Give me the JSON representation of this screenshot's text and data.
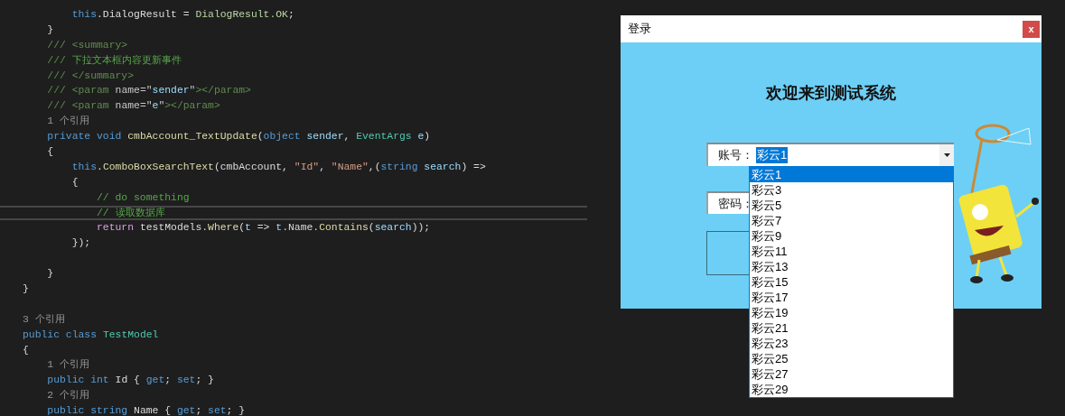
{
  "code_editor": {
    "lines": [
      {
        "current": false,
        "tokens": [
          {
            "text": "        this",
            "kind": "keyword"
          },
          {
            "text": ".DialogResult = ",
            "kind": "plain"
          },
          {
            "text": "DialogResult.OK",
            "kind": "enum"
          },
          {
            "text": ";",
            "kind": "plain"
          }
        ]
      },
      {
        "current": false,
        "tokens": [
          {
            "text": "    }",
            "kind": "plain"
          }
        ]
      },
      {
        "current": false,
        "tokens": [
          {
            "text": "    /// <summary>",
            "kind": "doc"
          }
        ]
      },
      {
        "current": false,
        "tokens": [
          {
            "text": "    /// ",
            "kind": "doc"
          },
          {
            "text": "下拉文本框内容更新事件",
            "kind": "comment"
          }
        ]
      },
      {
        "current": false,
        "tokens": [
          {
            "text": "    /// </summary>",
            "kind": "doc"
          }
        ]
      },
      {
        "current": false,
        "tokens": [
          {
            "text": "    /// <param ",
            "kind": "doc"
          },
          {
            "text": "name=\"",
            "kind": "docattr"
          },
          {
            "text": "sender",
            "kind": "param"
          },
          {
            "text": "\"",
            "kind": "docattr"
          },
          {
            "text": "></param>",
            "kind": "doc"
          }
        ]
      },
      {
        "current": false,
        "tokens": [
          {
            "text": "    /// <param ",
            "kind": "doc"
          },
          {
            "text": "name=\"",
            "kind": "docattr"
          },
          {
            "text": "e",
            "kind": "param"
          },
          {
            "text": "\"",
            "kind": "docattr"
          },
          {
            "text": "></param>",
            "kind": "doc"
          }
        ]
      },
      {
        "current": false,
        "tokens": [
          {
            "text": "    1 个引用",
            "kind": "lens"
          }
        ]
      },
      {
        "current": false,
        "tokens": [
          {
            "text": "    private void ",
            "kind": "keyword"
          },
          {
            "text": "cmbAccount_TextUpdate",
            "kind": "method"
          },
          {
            "text": "(",
            "kind": "plain"
          },
          {
            "text": "object ",
            "kind": "keyword"
          },
          {
            "text": "sender",
            "kind": "param"
          },
          {
            "text": ", ",
            "kind": "plain"
          },
          {
            "text": "EventArgs ",
            "kind": "type"
          },
          {
            "text": "e",
            "kind": "param"
          },
          {
            "text": ")",
            "kind": "plain"
          }
        ]
      },
      {
        "current": false,
        "tokens": [
          {
            "text": "    {",
            "kind": "plain"
          }
        ]
      },
      {
        "current": false,
        "tokens": [
          {
            "text": "        this",
            "kind": "keyword"
          },
          {
            "text": ".",
            "kind": "plain"
          },
          {
            "text": "ComboBoxSearchText",
            "kind": "method"
          },
          {
            "text": "(cmbAccount, ",
            "kind": "plain"
          },
          {
            "text": "\"Id\"",
            "kind": "string"
          },
          {
            "text": ", ",
            "kind": "plain"
          },
          {
            "text": "\"Name\"",
            "kind": "string"
          },
          {
            "text": ",(",
            "kind": "plain"
          },
          {
            "text": "string ",
            "kind": "keyword"
          },
          {
            "text": "search",
            "kind": "param"
          },
          {
            "text": ") =>",
            "kind": "plain"
          }
        ]
      },
      {
        "current": false,
        "tokens": [
          {
            "text": "        {",
            "kind": "plain"
          }
        ]
      },
      {
        "current": false,
        "tokens": [
          {
            "text": "            // do something",
            "kind": "comment"
          }
        ]
      },
      {
        "current": true,
        "tokens": [
          {
            "text": "            // 读取数据库",
            "kind": "comment"
          }
        ]
      },
      {
        "current": false,
        "tokens": [
          {
            "text": "            return ",
            "kind": "control"
          },
          {
            "text": "testModels.",
            "kind": "plain"
          },
          {
            "text": "Where",
            "kind": "method"
          },
          {
            "text": "(",
            "kind": "plain"
          },
          {
            "text": "t",
            "kind": "param"
          },
          {
            "text": " => ",
            "kind": "plain"
          },
          {
            "text": "t",
            "kind": "param"
          },
          {
            "text": ".Name.",
            "kind": "plain"
          },
          {
            "text": "Contains",
            "kind": "method"
          },
          {
            "text": "(",
            "kind": "plain"
          },
          {
            "text": "search",
            "kind": "param"
          },
          {
            "text": "));",
            "kind": "plain"
          }
        ]
      },
      {
        "current": false,
        "tokens": [
          {
            "text": "        });",
            "kind": "plain"
          }
        ]
      },
      {
        "current": false,
        "spaced": true,
        "tokens": [
          {
            "text": "    }",
            "kind": "plain"
          }
        ]
      },
      {
        "current": false,
        "tokens": [
          {
            "text": "}",
            "kind": "plain"
          }
        ]
      },
      {
        "current": false,
        "spaced": true,
        "tokens": [
          {
            "text": "3 个引用",
            "kind": "lens"
          }
        ]
      },
      {
        "current": false,
        "tokens": [
          {
            "text": "public class ",
            "kind": "keyword"
          },
          {
            "text": "TestModel",
            "kind": "type"
          }
        ]
      },
      {
        "current": false,
        "tokens": [
          {
            "text": "{",
            "kind": "plain"
          }
        ]
      },
      {
        "current": false,
        "tokens": [
          {
            "text": "    1 个引用",
            "kind": "lens"
          }
        ]
      },
      {
        "current": false,
        "tokens": [
          {
            "text": "    public int ",
            "kind": "keyword"
          },
          {
            "text": "Id { ",
            "kind": "plain"
          },
          {
            "text": "get",
            "kind": "keyword"
          },
          {
            "text": "; ",
            "kind": "plain"
          },
          {
            "text": "set",
            "kind": "keyword"
          },
          {
            "text": "; }",
            "kind": "plain"
          }
        ]
      },
      {
        "current": false,
        "tokens": [
          {
            "text": "    2 个引用",
            "kind": "lens"
          }
        ]
      },
      {
        "current": false,
        "tokens": [
          {
            "text": "    public string ",
            "kind": "keyword"
          },
          {
            "text": "Name { ",
            "kind": "plain"
          },
          {
            "text": "get",
            "kind": "keyword"
          },
          {
            "text": "; ",
            "kind": "plain"
          },
          {
            "text": "set",
            "kind": "keyword"
          },
          {
            "text": "; }",
            "kind": "plain"
          }
        ]
      }
    ]
  },
  "dialog": {
    "title": "登录",
    "close_button": "x",
    "heading": "欢迎来到测试系统",
    "account": {
      "label": "账号：",
      "value": "彩云1",
      "text_selected": true,
      "options": [
        {
          "label": "彩云1",
          "selected": true
        },
        {
          "label": "彩云3",
          "selected": false
        },
        {
          "label": "彩云5",
          "selected": false
        },
        {
          "label": "彩云7",
          "selected": false
        },
        {
          "label": "彩云9",
          "selected": false
        },
        {
          "label": "彩云11",
          "selected": false
        },
        {
          "label": "彩云13",
          "selected": false
        },
        {
          "label": "彩云15",
          "selected": false
        },
        {
          "label": "彩云17",
          "selected": false
        },
        {
          "label": "彩云19",
          "selected": false
        },
        {
          "label": "彩云21",
          "selected": false
        },
        {
          "label": "彩云23",
          "selected": false
        },
        {
          "label": "彩云25",
          "selected": false
        },
        {
          "label": "彩云27",
          "selected": false
        },
        {
          "label": "彩云29",
          "selected": false
        }
      ]
    },
    "password": {
      "label": "密码："
    }
  }
}
